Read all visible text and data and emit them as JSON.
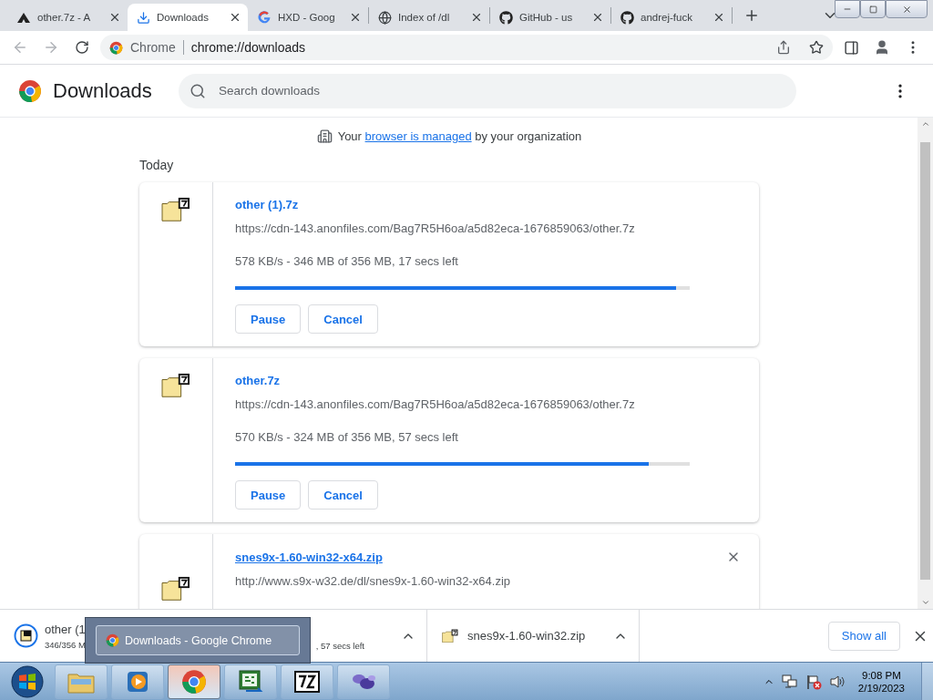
{
  "tabs": [
    {
      "kind": "triangle",
      "title": "other.7z - A",
      "selected": false
    },
    {
      "kind": "download",
      "title": "Downloads",
      "selected": true
    },
    {
      "kind": "google",
      "title": "HXD - Goog",
      "selected": false
    },
    {
      "kind": "globe",
      "title": "Index of /dl",
      "selected": false
    },
    {
      "kind": "github",
      "title": "GitHub - us",
      "selected": false
    },
    {
      "kind": "github",
      "title": "andrej-fuck",
      "selected": false
    }
  ],
  "toolbar": {
    "site_chip": "Chrome",
    "url": "chrome://downloads"
  },
  "page": {
    "title": "Downloads",
    "search": {
      "placeholder": "Search downloads"
    },
    "managed_notice": {
      "before": "Your",
      "link": "browser is managed",
      "after": "by your organization"
    },
    "section": "Today",
    "downloads": [
      {
        "name": "other (1).7z",
        "hovered": false,
        "url": "https://cdn-143.anonfiles.com/Bag7R5H6oa/a5d82eca-1676859063/other.7z",
        "status": "578 KB/s - 346 MB of 356 MB, 17 secs left",
        "level": 0.97,
        "buttons": [
          "Pause",
          "Cancel"
        ],
        "removable": false
      },
      {
        "name": "other.7z",
        "hovered": false,
        "url": "https://cdn-143.anonfiles.com/Bag7R5H6oa/a5d82eca-1676859063/other.7z",
        "status": "570 KB/s - 324 MB of 356 MB, 57 secs left",
        "level": 0.91,
        "buttons": [
          "Pause",
          "Cancel"
        ],
        "removable": false
      },
      {
        "name": "snes9x-1.60-win32-x64.zip",
        "hovered": true,
        "url": "http://www.s9x-w32.de/dl/snes9x-1.60-win32-x64.zip",
        "removable": true
      }
    ]
  },
  "shelf": {
    "items": [
      {
        "kind": "progress",
        "name": "other (1",
        "status": "346/356 M"
      },
      {
        "kind": "hidden",
        "status": ", 57 secs left"
      },
      {
        "kind": "done",
        "name": "snes9x-1.60-win32.zip"
      }
    ],
    "show_all": "Show all"
  },
  "taskbar": {
    "preview": "Downloads - Google Chrome",
    "apps": [
      {
        "kind": "explorer",
        "active": false
      },
      {
        "kind": "media",
        "active": false
      },
      {
        "kind": "chrome",
        "active": true
      },
      {
        "kind": "csharp",
        "active": false
      },
      {
        "kind": "sevenzip",
        "active": false
      },
      {
        "kind": "purple",
        "active": false
      }
    ],
    "time": "9:08 PM",
    "date": "2/19/2023"
  }
}
